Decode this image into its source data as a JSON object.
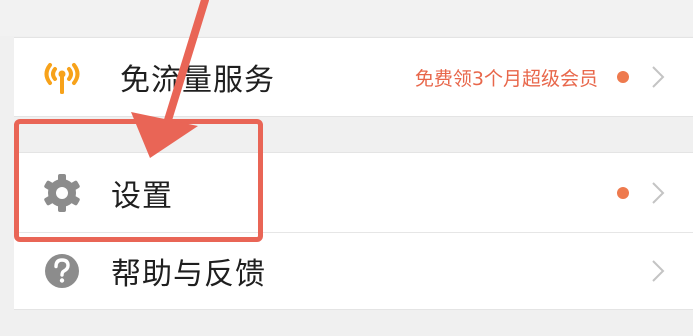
{
  "menu": {
    "items": [
      {
        "key": "free_data",
        "label": "免流量服务",
        "icon": "antenna-signal-icon",
        "promo": "免费领3个月超级会员",
        "has_dot": true
      },
      {
        "key": "settings",
        "label": "设置",
        "icon": "gear-icon",
        "has_dot": true
      },
      {
        "key": "help",
        "label": "帮助与反馈",
        "icon": "question-circle-icon",
        "has_dot": false
      }
    ]
  },
  "colors": {
    "accent_orange": "#f7a21a",
    "promo_text": "#e8674b",
    "notification_dot": "#ee7a4e",
    "annotation_red": "#e96556",
    "icon_gray": "#8c8c8c",
    "chevron_gray": "#c4c4c4"
  }
}
